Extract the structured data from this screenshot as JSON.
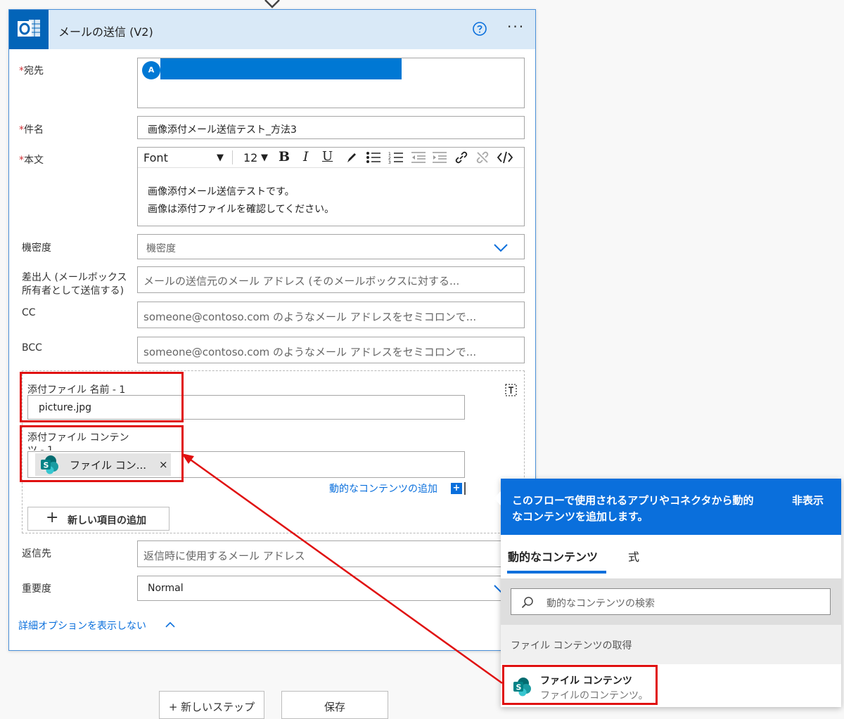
{
  "card": {
    "title": "メールの送信 (V2)",
    "help_icon": "help-circle-icon",
    "more_label": "···"
  },
  "fields": {
    "to": {
      "label": "宛先",
      "required_mark": "*",
      "chip_initial": "A",
      "chip_color": "#0078d4"
    },
    "subject": {
      "label": "件名",
      "required_mark": "*",
      "value": "画像添付メール送信テスト_方法3"
    },
    "body": {
      "label": "本文",
      "required_mark": "*",
      "font_label": "Font",
      "font_size": "12",
      "line1": "画像添付メール送信テストです。",
      "line2": "画像は添付ファイルを確認してください。"
    },
    "sensitivity": {
      "label": "機密度",
      "placeholder": "機密度"
    },
    "from": {
      "label_line1": "差出人 (メールボックス",
      "label_line2": "所有者として送信する)",
      "placeholder": "メールの送信元のメール アドレス (そのメールボックスに対する..."
    },
    "cc": {
      "label": "CC",
      "placeholder": "someone@contoso.com のようなメール アドレスをセミコロンで..."
    },
    "bcc": {
      "label": "BCC",
      "placeholder": "someone@contoso.com のようなメール アドレスをセミコロンで..."
    },
    "attachment_name": {
      "label": "添付ファイル 名前 - 1",
      "value": "picture.jpg"
    },
    "attachment_content": {
      "label_line1": "添付ファイル コンテン",
      "label_line2": "ツ - 1",
      "chip_label": "ファイル コン...",
      "chip_close": "×"
    },
    "dynamic_link": "動的なコンテンツの追加",
    "add_item": "新しい項目の追加",
    "reply_to": {
      "label": "返信先",
      "placeholder": "返信時に使用するメール アドレス"
    },
    "importance": {
      "label": "重要度",
      "value": "Normal"
    },
    "advanced_toggle": "詳細オプションを表示しない"
  },
  "panel": {
    "description_line1": "このフローで使用されるアプリやコネクタから動的",
    "description_line2": "なコンテンツを追加します。",
    "hide_label": "非表示",
    "tabs": [
      "動的なコンテンツ",
      "式"
    ],
    "search_placeholder": "動的なコンテンツの検索",
    "section_title": "ファイル コンテンツの取得",
    "item_title": "ファイル コンテンツ",
    "item_subtitle": "ファイルのコンテンツ。"
  },
  "bottom": {
    "new_step": "+ 新しいステップ",
    "save": "保存"
  },
  "colors": {
    "accent": "#0a6fdc",
    "outlook": "#0364b8",
    "highlight": "#e01010",
    "sharepoint": "#038387"
  }
}
